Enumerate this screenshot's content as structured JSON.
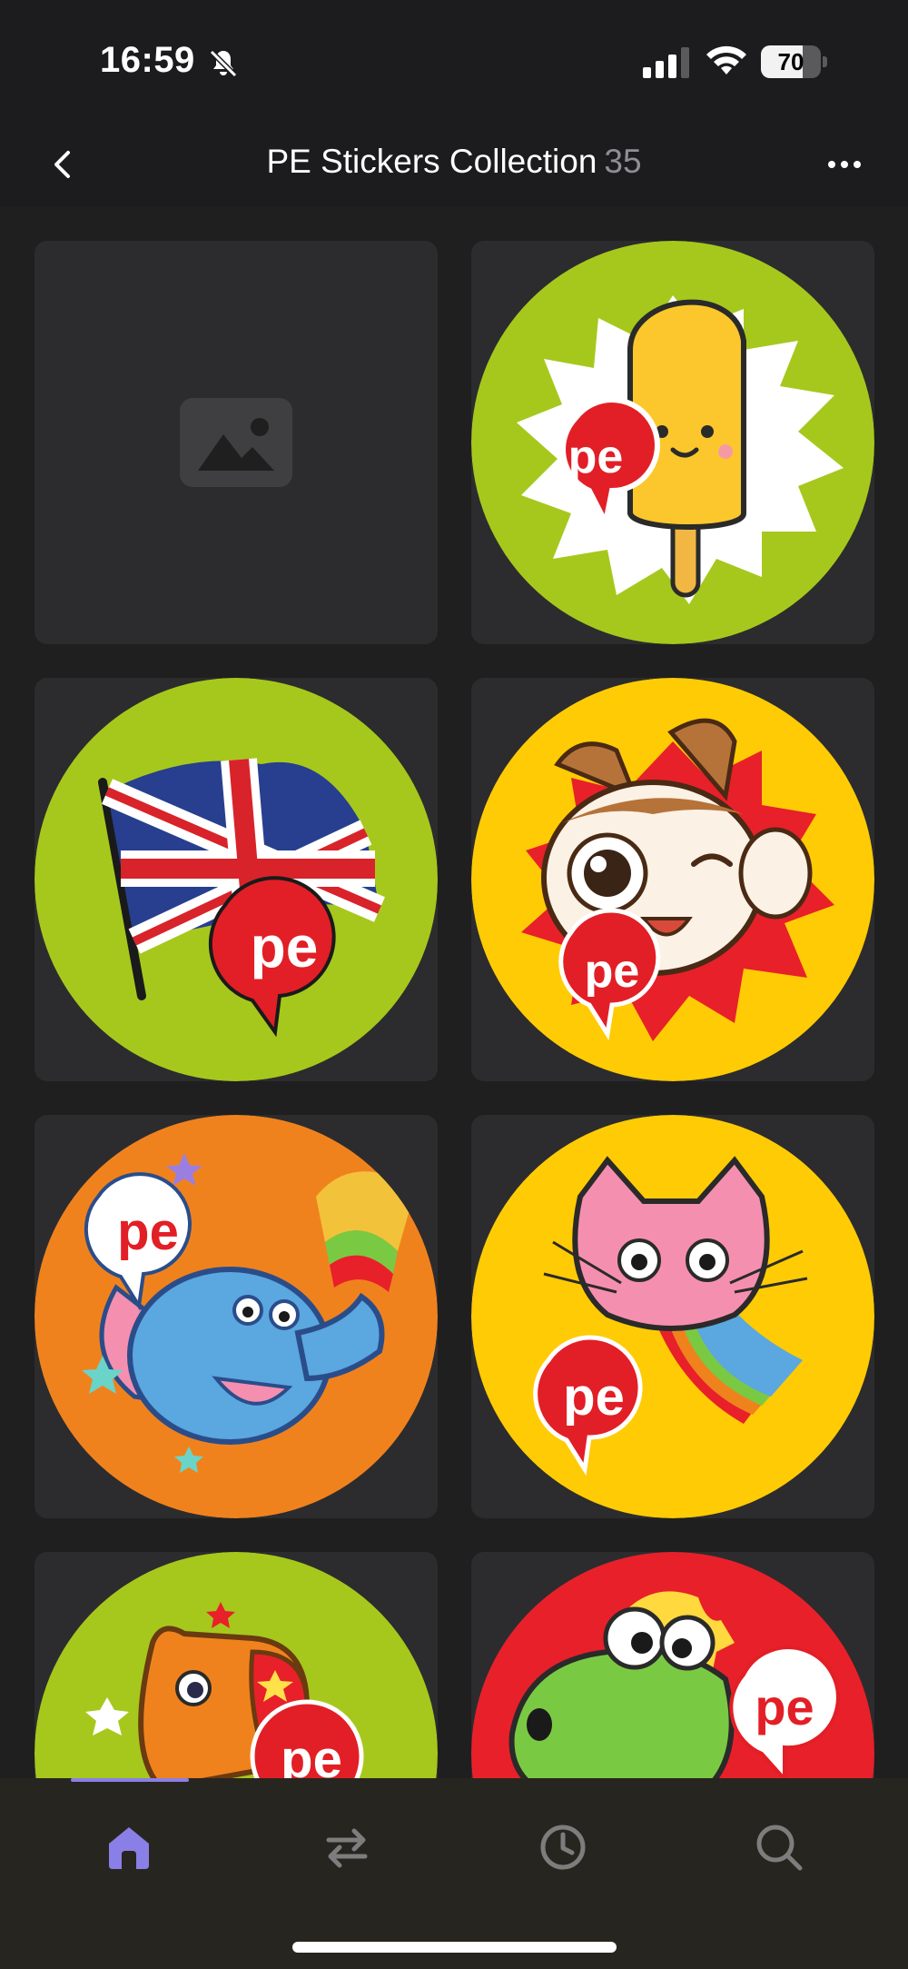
{
  "status_bar": {
    "time": "16:59",
    "battery": "70",
    "battery_level": 0.7
  },
  "nav": {
    "title": "PE Stickers Collection",
    "count": "35"
  },
  "logo_text": "pe",
  "stickers": [
    {
      "type": "placeholder",
      "icon": "image-placeholder-icon"
    },
    {
      "type": "sticker",
      "subject": "ice-pop",
      "background": "#a6c81d"
    },
    {
      "type": "sticker",
      "subject": "uk-flag",
      "background": "#a6c81d"
    },
    {
      "type": "sticker",
      "subject": "winking-cat",
      "background": "#ffcb05"
    },
    {
      "type": "sticker",
      "subject": "elephant",
      "background": "#f0821e"
    },
    {
      "type": "sticker",
      "subject": "rainbow-cat",
      "background": "#ffcb05"
    },
    {
      "type": "sticker",
      "subject": "capybara",
      "background": "#a6c81d"
    },
    {
      "type": "sticker",
      "subject": "dinosaur",
      "background": "#e8202a"
    }
  ],
  "tabs": [
    {
      "name": "home",
      "icon": "home-icon",
      "active": true
    },
    {
      "name": "transfer",
      "icon": "transfer-icon",
      "active": false
    },
    {
      "name": "history",
      "icon": "clock-icon",
      "active": false
    },
    {
      "name": "search",
      "icon": "search-icon",
      "active": false
    }
  ],
  "colors": {
    "accent": "#8a7fe6",
    "badge_red": "#e21f26",
    "background": "#1f1f1f"
  }
}
